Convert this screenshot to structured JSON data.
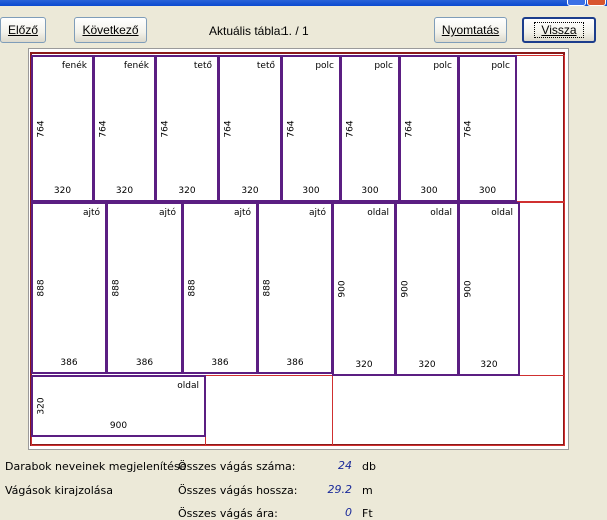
{
  "toolbar": {
    "prev_label": "Előző",
    "next_label": "Következő",
    "current_table_label": "Aktuális tábla:",
    "current_table_value": "1. / 1",
    "print_label": "Nyomtatás",
    "back_label": "Vissza"
  },
  "row1": [
    {
      "name": "fenék",
      "width": "320",
      "height": "764"
    },
    {
      "name": "fenék",
      "width": "320",
      "height": "764"
    },
    {
      "name": "tető",
      "width": "320",
      "height": "764"
    },
    {
      "name": "tető",
      "width": "320",
      "height": "764"
    },
    {
      "name": "polc",
      "width": "300",
      "height": "764"
    },
    {
      "name": "polc",
      "width": "300",
      "height": "764"
    },
    {
      "name": "polc",
      "width": "300",
      "height": "764"
    },
    {
      "name": "polc",
      "width": "300",
      "height": "764"
    }
  ],
  "row2": [
    {
      "name": "ajtó",
      "width": "386",
      "height": "888"
    },
    {
      "name": "ajtó",
      "width": "386",
      "height": "888"
    },
    {
      "name": "ajtó",
      "width": "386",
      "height": "888"
    },
    {
      "name": "ajtó",
      "width": "386",
      "height": "888"
    },
    {
      "name": "oldal",
      "width": "320",
      "height": "900"
    },
    {
      "name": "oldal",
      "width": "320",
      "height": "900"
    },
    {
      "name": "oldal",
      "width": "320",
      "height": "900"
    }
  ],
  "row3": [
    {
      "name": "oldal",
      "width": "900",
      "height": "320"
    }
  ],
  "options": {
    "show_names": "Darabok neveinek megjelenítése",
    "draw_cuts": "Vágások kirajzolása"
  },
  "stats": {
    "cut_count_label": "Összes vágás száma:",
    "cut_count_value": "24",
    "cut_count_unit": "db",
    "cut_length_label": "Összes vágás hossza:",
    "cut_length_value": "29.2",
    "cut_length_unit": "m",
    "cut_price_label": "Összes vágás ára:",
    "cut_price_value": "0",
    "cut_price_unit": "Ft"
  }
}
